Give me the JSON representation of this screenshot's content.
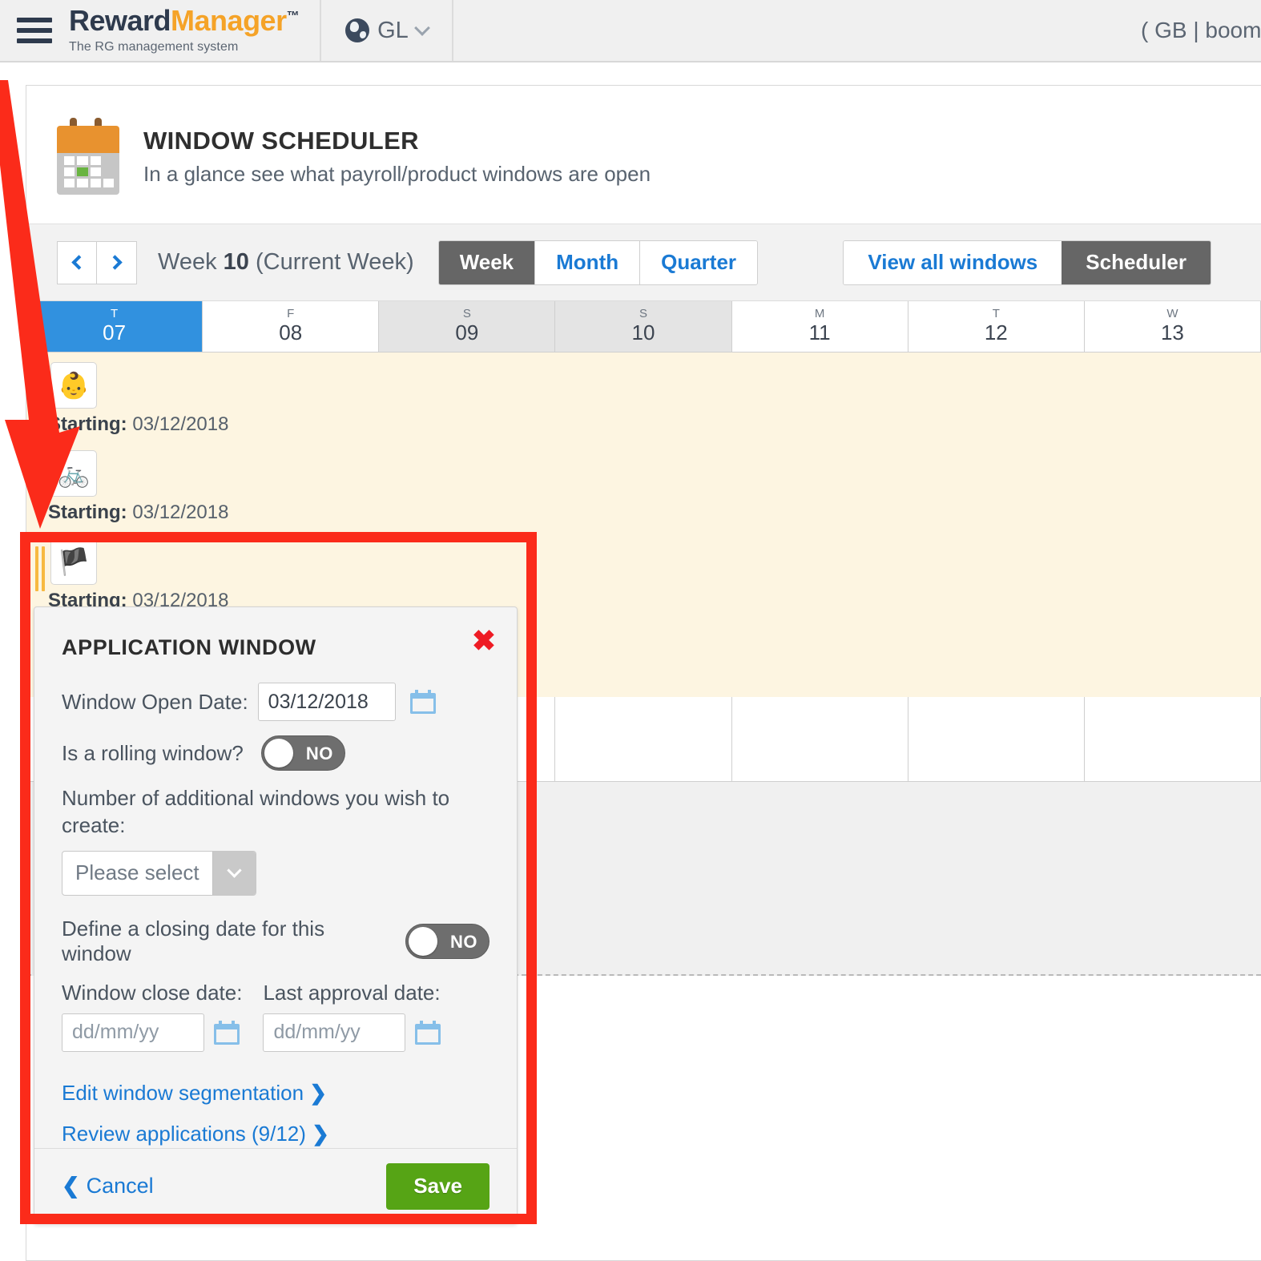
{
  "topbar": {
    "menu_icon": "hamburger-icon",
    "brand_part1": "Reward",
    "brand_part2": "Manager",
    "brand_tm": "™",
    "brand_tagline": "The RG management system",
    "region_icon": "globe-icon",
    "region_label": "GL",
    "region_chevron": "chevron-down-icon",
    "user_text": "( GB | boom!"
  },
  "page": {
    "icon": "calendar-icon",
    "title": "WINDOW SCHEDULER",
    "subtitle": "In a glance see what payroll/product windows are open"
  },
  "toolbar": {
    "prev_icon": "chevron-left-icon",
    "next_icon": "chevron-right-icon",
    "week_prefix": "Week",
    "week_number": "10",
    "week_suffix": "(Current Week)",
    "ranges": [
      {
        "label": "Week",
        "active": true
      },
      {
        "label": "Month",
        "active": false
      },
      {
        "label": "Quarter",
        "active": false
      }
    ],
    "views": [
      {
        "label": "View all windows",
        "active": false
      },
      {
        "label": "Scheduler",
        "active": true
      }
    ]
  },
  "calendar": {
    "days": [
      {
        "dow": "T",
        "num": "07",
        "state": "today"
      },
      {
        "dow": "F",
        "num": "08",
        "state": "normal"
      },
      {
        "dow": "S",
        "num": "09",
        "state": "weekend"
      },
      {
        "dow": "S",
        "num": "10",
        "state": "weekend"
      },
      {
        "dow": "M",
        "num": "11",
        "state": "normal"
      },
      {
        "dow": "T",
        "num": "12",
        "state": "normal"
      },
      {
        "dow": "W",
        "num": "13",
        "state": "normal"
      }
    ],
    "events": [
      {
        "icon": "baby-carriage-icon",
        "glyph": "👶",
        "start_label": "Starting:",
        "start_date": "03/12/2018"
      },
      {
        "icon": "bicycle-icon",
        "glyph": "🚲",
        "start_label": "Starting:",
        "start_date": "03/12/2018"
      },
      {
        "icon": "signpost-icon",
        "glyph": "🏴",
        "start_label": "Starting:",
        "start_date": "03/12/2018"
      }
    ]
  },
  "modal": {
    "title": "APPLICATION WINDOW",
    "close_icon": "close-icon",
    "open_date_label": "Window Open Date:",
    "open_date_value": "03/12/2018",
    "open_date_calendar_icon": "calendar-picker-icon",
    "rolling_label": "Is a rolling window?",
    "rolling_value": "NO",
    "additional_label": "Number of additional windows you wish to create:",
    "additional_select_value": "Please select",
    "additional_select_chevron": "chevron-down-icon",
    "closing_label": "Define a closing date for this window",
    "closing_value": "NO",
    "close_date_label": "Window close date:",
    "close_date_placeholder": "dd/mm/yy",
    "close_date_calendar_icon": "calendar-picker-icon",
    "approval_date_label": "Last approval date:",
    "approval_date_placeholder": "dd/mm/yy",
    "approval_date_calendar_icon": "calendar-picker-icon",
    "edit_segmentation_link": "Edit window segmentation",
    "edit_segmentation_caret": "❯",
    "review_applications_link": "Review applications (9/12)",
    "review_applications_caret": "❯",
    "window_icon": "signpost-icon",
    "window_icon_glyph": "🏴",
    "cancel_label": "Cancel",
    "cancel_caret": "❮",
    "save_label": "Save"
  },
  "annotations": {
    "arrow_color": "#fb2b1a",
    "box_color": "#fb2b1a"
  }
}
